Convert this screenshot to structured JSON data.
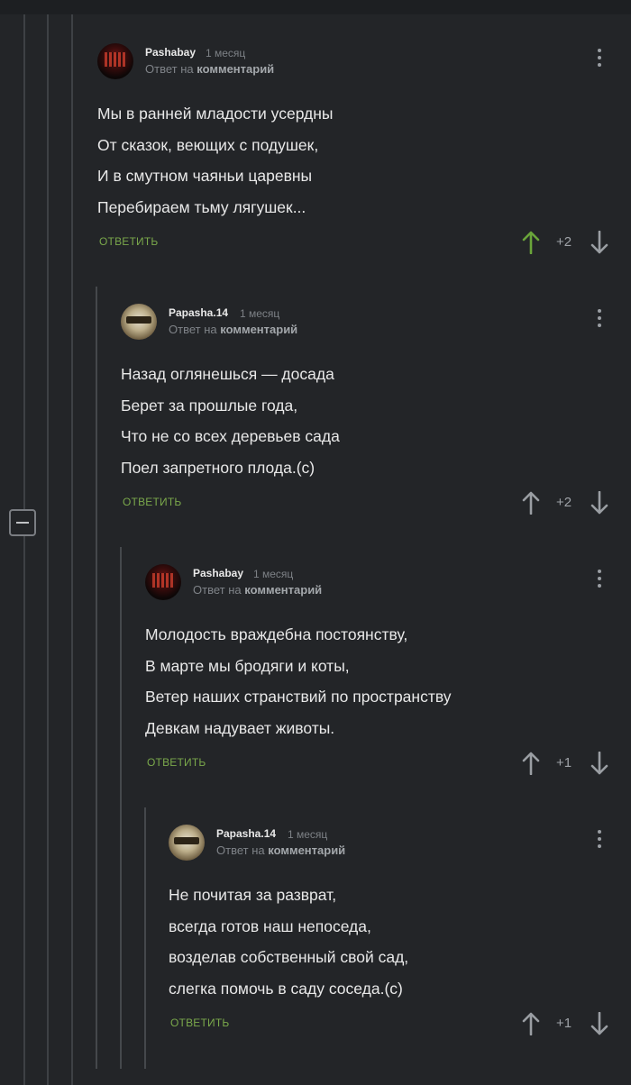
{
  "common": {
    "reply_label": "ОТВЕТИТЬ",
    "reply_to_prefix": "Ответ на",
    "reply_to_target": "комментарий"
  },
  "comments": [
    {
      "username": "Pashabay",
      "time": "1 месяц",
      "avatar": "pashabay-avatar",
      "lines": [
        "Мы в ранней младости усердны",
        "От сказок, веющих с подушек,",
        "И в смутном чаяньи царевны",
        "Перебираем тьму лягушек..."
      ],
      "score": "+2",
      "upvoted": true
    },
    {
      "username": "Papasha.14",
      "time": "1 месяц",
      "avatar": "papasha-avatar",
      "lines": [
        "Назад оглянешься — досада",
        "Берет за прошлые года,",
        "Что не со всех деревьев сада",
        "Поел запретного плода.(с)"
      ],
      "score": "+2",
      "upvoted": false
    },
    {
      "username": "Pashabay",
      "time": "1 месяц",
      "avatar": "pashabay-avatar",
      "lines": [
        "Молодость враждебна постоянству,",
        "В марте мы бродяги и коты,",
        "Ветер наших странствий по пространству",
        "Девкам надувает животы."
      ],
      "score": "+1",
      "upvoted": false
    },
    {
      "username": "Papasha.14",
      "time": "1 месяц",
      "avatar": "papasha-avatar",
      "lines": [
        "Не почитая за разврат,",
        "всегда готов наш непоседа,",
        "возделав собственный свой сад,",
        "слегка помочь в саду соседа.(с)"
      ],
      "score": "+1",
      "upvoted": false
    }
  ],
  "colors": {
    "background": "#232528",
    "reply": "#7aa84b",
    "upvote_active": "#6aa53a",
    "arrow": "#9a9ea3"
  },
  "icons": {
    "collapse": "minus-square-icon",
    "menu": "more-vertical-icon",
    "upvote": "arrow-up-icon",
    "downvote": "arrow-down-icon"
  }
}
